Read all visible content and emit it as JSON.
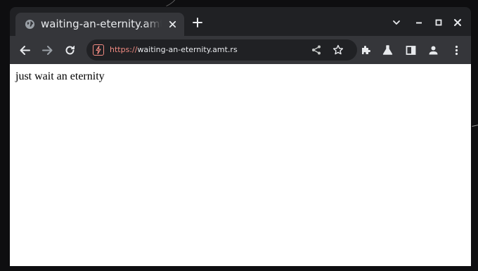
{
  "browser": {
    "tab": {
      "title": "waiting-an-eternity.amt.rs",
      "favicon": "globe-icon"
    },
    "window_controls": [
      "tab-search-icon",
      "minimize-icon",
      "maximize-icon",
      "close-icon"
    ],
    "url": {
      "scheme": "https://",
      "host": "waiting-an-eternity.amt.rs"
    },
    "toolbar_icons": [
      "back-icon",
      "forward-icon",
      "reload-icon",
      "share-icon",
      "star-icon",
      "extensions-icon",
      "labs-icon",
      "side-panel-icon",
      "profile-icon",
      "kebab-menu-icon"
    ],
    "colors": {
      "frame": "#202124",
      "toolbar": "#35363a",
      "insecure_accent": "#f28b82",
      "text": "#e8eaed"
    }
  },
  "page": {
    "body_text": "just wait an eternity"
  }
}
